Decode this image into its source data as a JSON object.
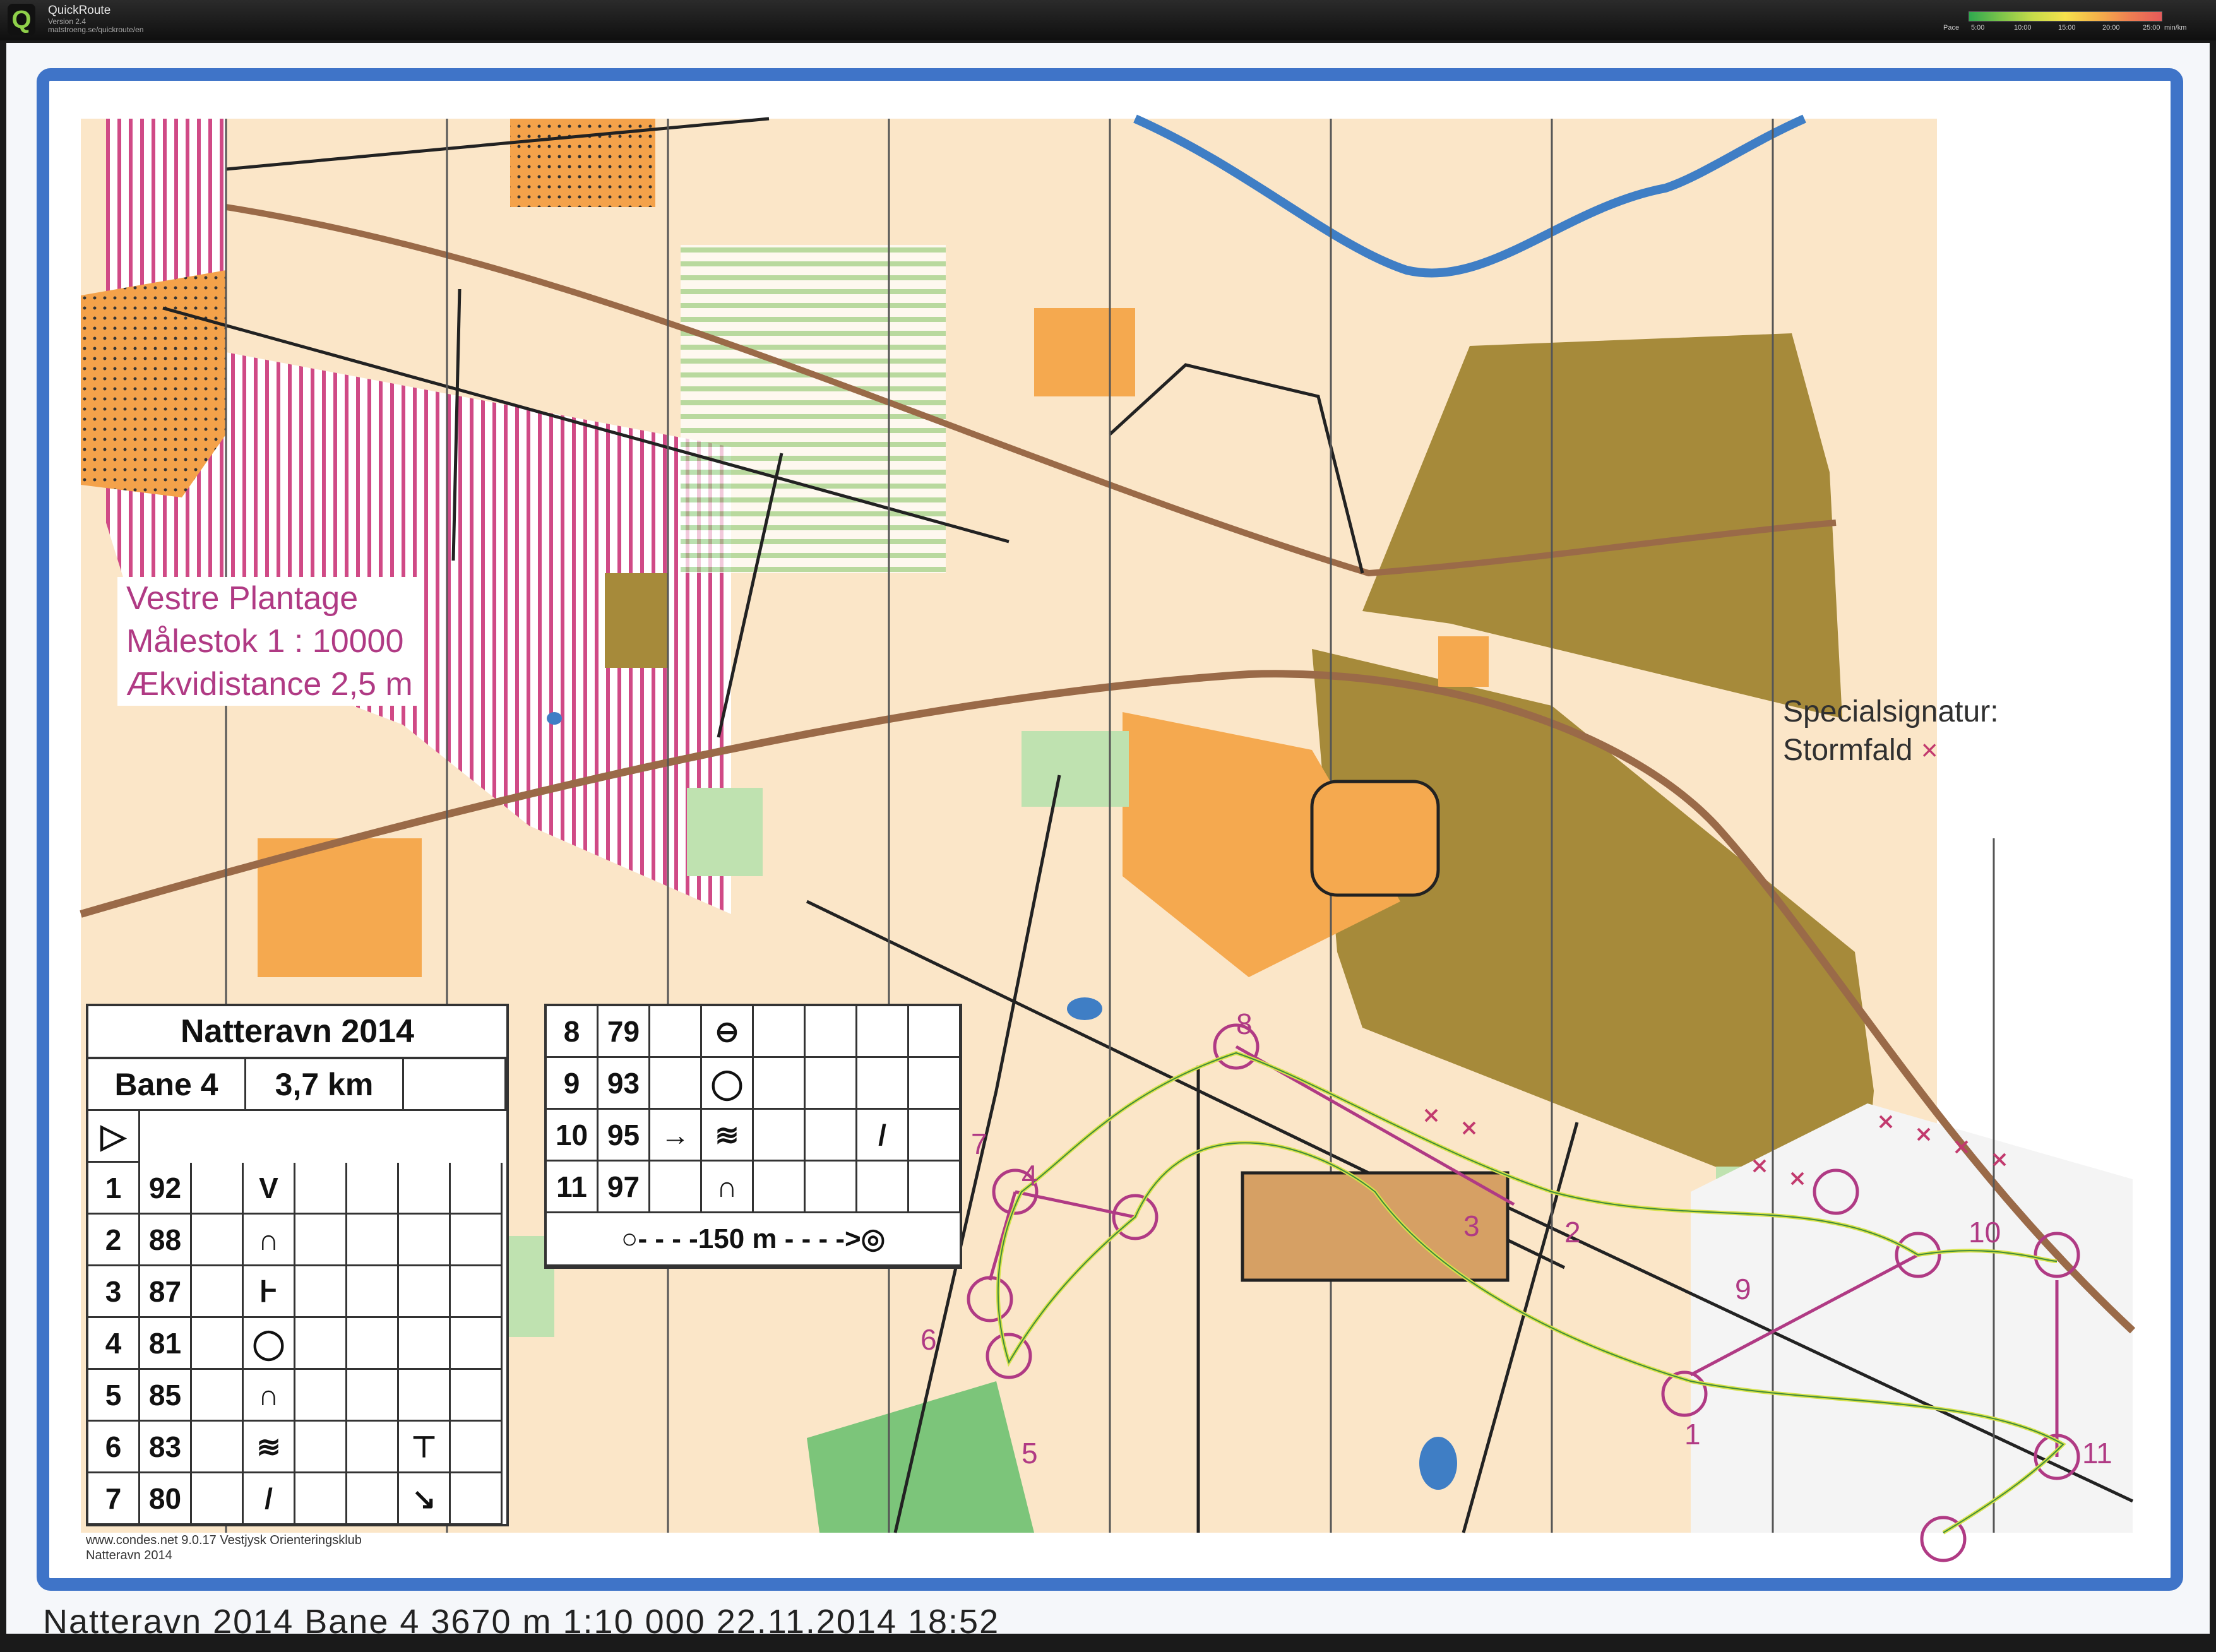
{
  "app": {
    "name": "QuickRoute",
    "version": "Version 2.4",
    "url": "matstroeng.se/quickroute/en"
  },
  "speed_legend": {
    "label": "Pace",
    "ticks": [
      "5:00",
      "10:00",
      "15:00",
      "20:00",
      "25:00"
    ],
    "unit": "min/km",
    "colors": [
      "#2fa84f",
      "#7dc44a",
      "#c7dc4a",
      "#f6e14c",
      "#f5b24a",
      "#ef7f52",
      "#e65a5a"
    ]
  },
  "map": {
    "area_name": "Vestre Plantage",
    "scale": "Målestok 1 : 10000",
    "contour": "Ækvidistance 2,5 m",
    "special_title": "Specialsignatur:",
    "special_item": "Stormfald",
    "special_symbol": "×",
    "footer_line1": "www.condes.net 9.0.17 Vestjysk Orienteringsklub",
    "footer_line2": "Natteravn 2014",
    "bottom_caption": "Natteravn 2014     Bane 4     3670 m     1:10 000     22.11.2014 18:52",
    "control_numbers": [
      "1",
      "2",
      "3",
      "4",
      "5",
      "6",
      "7",
      "8",
      "9",
      "10",
      "11"
    ],
    "colors": {
      "frame": "#3f74c8",
      "course": "#b03a84",
      "open": "#f5a94f",
      "rough": "#fad7a0",
      "green": "#9cd38c",
      "urban": "#a68a3a"
    }
  },
  "description": {
    "title": "Natteravn 2014",
    "course": "Bane 4",
    "length": "3,7 km",
    "start_symbol": "▷",
    "rows": [
      {
        "no": "1",
        "code": "92",
        "symbol": "V",
        "extra": ""
      },
      {
        "no": "2",
        "code": "88",
        "symbol": "∩",
        "extra": ""
      },
      {
        "no": "3",
        "code": "87",
        "symbol": "Ͱ",
        "extra": ""
      },
      {
        "no": "4",
        "code": "81",
        "symbol": "◯",
        "extra": ""
      },
      {
        "no": "5",
        "code": "85",
        "symbol": "∩",
        "extra": ""
      },
      {
        "no": "6",
        "code": "83",
        "symbol": "≋",
        "extra": "⊤"
      },
      {
        "no": "7",
        "code": "80",
        "symbol": "/",
        "extra": "↘"
      },
      {
        "no": "8",
        "code": "79",
        "symbol": "⊖",
        "extra": ""
      },
      {
        "no": "9",
        "code": "93",
        "symbol": "◯",
        "extra": ""
      },
      {
        "no": "10",
        "code": "95",
        "arrow": "→",
        "symbol": "≋",
        "extra": "/"
      },
      {
        "no": "11",
        "code": "97",
        "symbol": "∩",
        "extra": ""
      }
    ],
    "finish_text": "○- - - -150 m - - - ->◎"
  }
}
